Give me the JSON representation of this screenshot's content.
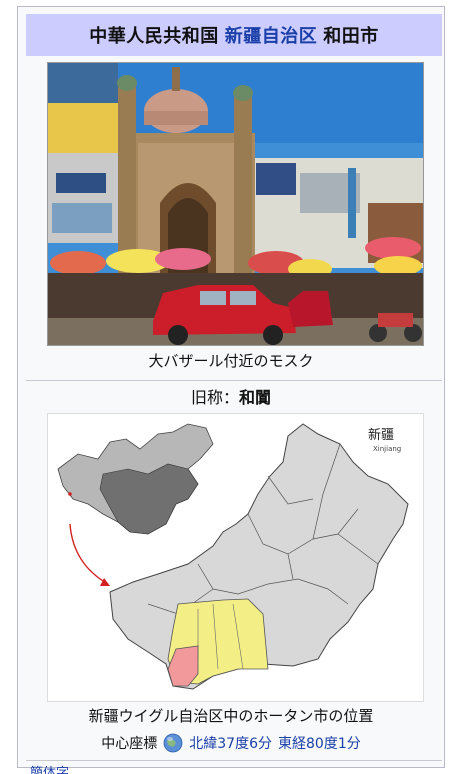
{
  "title": {
    "country": "中華人民共和国",
    "region": "新疆自治区",
    "city": "和田市"
  },
  "photo_caption": "大バザール付近のモスク",
  "former_name": {
    "label": "旧称：",
    "value": "和闐"
  },
  "map": {
    "label_cn": "新疆",
    "label_en": "Xinjiang",
    "caption": "新疆ウイグル自治区中のホータン市の位置"
  },
  "coordinates": {
    "label": "中心座標",
    "lat": "北緯37度6分",
    "lon": "東経80度1分"
  },
  "colors": {
    "title_bg": "#ccccff",
    "link": "#1a3fa8",
    "highlight_region": "#f4ee86",
    "highlight_city": "#f1999b"
  },
  "cut_link": "簡体字"
}
